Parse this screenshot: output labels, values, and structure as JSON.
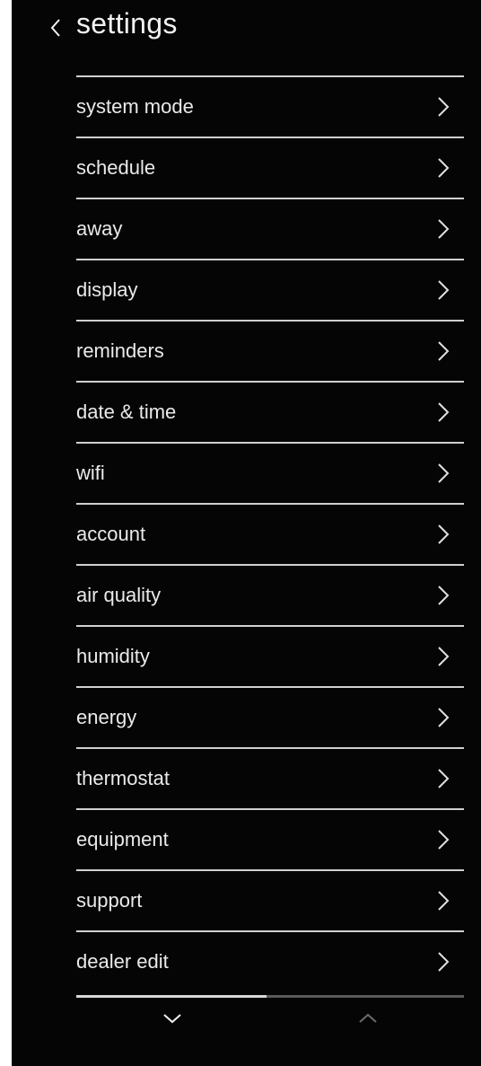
{
  "header": {
    "title": "settings",
    "back_icon": "chevron-left-icon"
  },
  "menu": {
    "items": [
      {
        "label": "system mode"
      },
      {
        "label": "schedule"
      },
      {
        "label": "away"
      },
      {
        "label": "display"
      },
      {
        "label": "reminders"
      },
      {
        "label": "date & time"
      },
      {
        "label": "wifi"
      },
      {
        "label": "account"
      },
      {
        "label": "air quality"
      },
      {
        "label": "humidity"
      },
      {
        "label": "energy"
      },
      {
        "label": "thermostat"
      },
      {
        "label": "equipment"
      },
      {
        "label": "support"
      },
      {
        "label": "dealer edit"
      }
    ],
    "item_icon": "chevron-right-icon"
  },
  "footer": {
    "scroll_down_icon": "chevron-down-icon",
    "scroll_up_icon": "chevron-up-icon",
    "scroll_down_enabled": true,
    "scroll_up_enabled": false
  },
  "colors": {
    "background": "#050505",
    "text": "#eaeaea",
    "divider": "#d0d0d0",
    "disabled": "#6a6a6a"
  }
}
